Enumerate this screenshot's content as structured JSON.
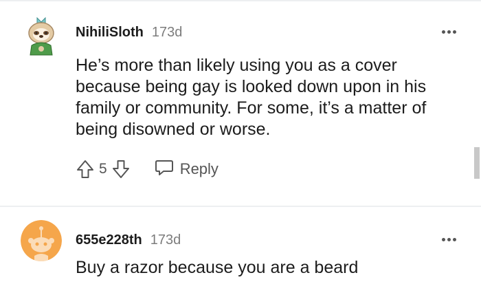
{
  "comments": [
    {
      "author": "NihiliSloth",
      "age": "173d",
      "text": "He’s more than likely using you as a cover because being gay is looked down upon in his family or community. For some, it’s a matter of being disowned or worse.",
      "score": "5",
      "reply_label": "Reply",
      "avatar_icon": "sloth-avatar-icon"
    },
    {
      "author": "655e228th",
      "age": "173d",
      "text": "Buy a razor because you are a beard",
      "avatar_icon": "snoo-avatar-icon"
    }
  ],
  "colors": {
    "divider": "#edeff1",
    "avatar_orange": "#f5a64b",
    "sloth_green": "#4f9b4a",
    "text": "#1c1c1c",
    "muted": "#7c7c7c"
  }
}
